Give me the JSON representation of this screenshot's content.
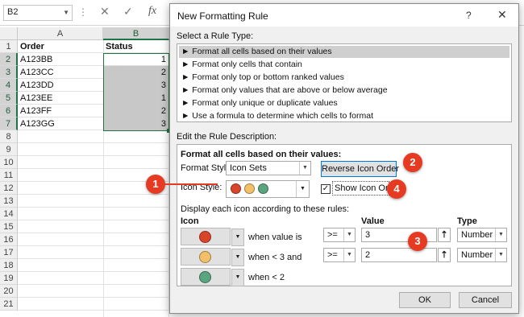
{
  "formula_bar": {
    "name_box": "B2",
    "dots": "⋮",
    "cancel": "✕",
    "enter": "✓",
    "fx": "fx"
  },
  "sheet": {
    "columns": [
      "A",
      "B"
    ],
    "rows": [
      "1",
      "2",
      "3",
      "4",
      "5",
      "6",
      "7",
      "8",
      "9",
      "10",
      "11",
      "12",
      "13",
      "14",
      "15",
      "16",
      "17",
      "18",
      "19",
      "20",
      "21"
    ],
    "header_a": "Order",
    "header_b": "Status",
    "data": [
      {
        "order": "A123BB",
        "status": "1"
      },
      {
        "order": "A123CC",
        "status": "2"
      },
      {
        "order": "A123DD",
        "status": "3"
      },
      {
        "order": "A123EE",
        "status": "1"
      },
      {
        "order": "A123FF",
        "status": "2"
      },
      {
        "order": "A123GG",
        "status": "3"
      }
    ]
  },
  "dialog": {
    "title": "New Formatting Rule",
    "help": "?",
    "close": "✕",
    "select_rule_type_label": "Select a Rule Type:",
    "rule_types": [
      "► Format all cells based on their values",
      "► Format only cells that contain",
      "► Format only top or bottom ranked values",
      "► Format only values that are above or below average",
      "► Format only unique or duplicate values",
      "► Use a formula to determine which cells to format"
    ],
    "edit_description_label": "Edit the Rule Description:",
    "format_all_label": "Format all cells based on their values:",
    "format_style_label": "Format Style:",
    "format_style_value": "Icon Sets",
    "reverse_icon_order": "Reverse Icon Order",
    "icon_style_label": "Icon Style:",
    "show_icon_only": "Show Icon Only",
    "show_icon_only_checked": "✓",
    "display_each_icon_label": "Display each icon according to these rules:",
    "col_icon": "Icon",
    "col_value": "Value",
    "col_type": "Type",
    "rules": [
      {
        "text": "when value is",
        "op": ">=",
        "value": "3",
        "type": "Number"
      },
      {
        "text": "when < 3 and",
        "op": ">=",
        "value": "2",
        "type": "Number"
      },
      {
        "text": "when < 2"
      }
    ],
    "ok": "OK",
    "cancel": "Cancel"
  },
  "colors": {
    "red": "#d9452b",
    "yellow": "#f3c06a",
    "green": "#5aa57f",
    "callout": "#e63a22",
    "excel_green": "#217346"
  },
  "callouts": [
    "1",
    "2",
    "3",
    "4"
  ]
}
